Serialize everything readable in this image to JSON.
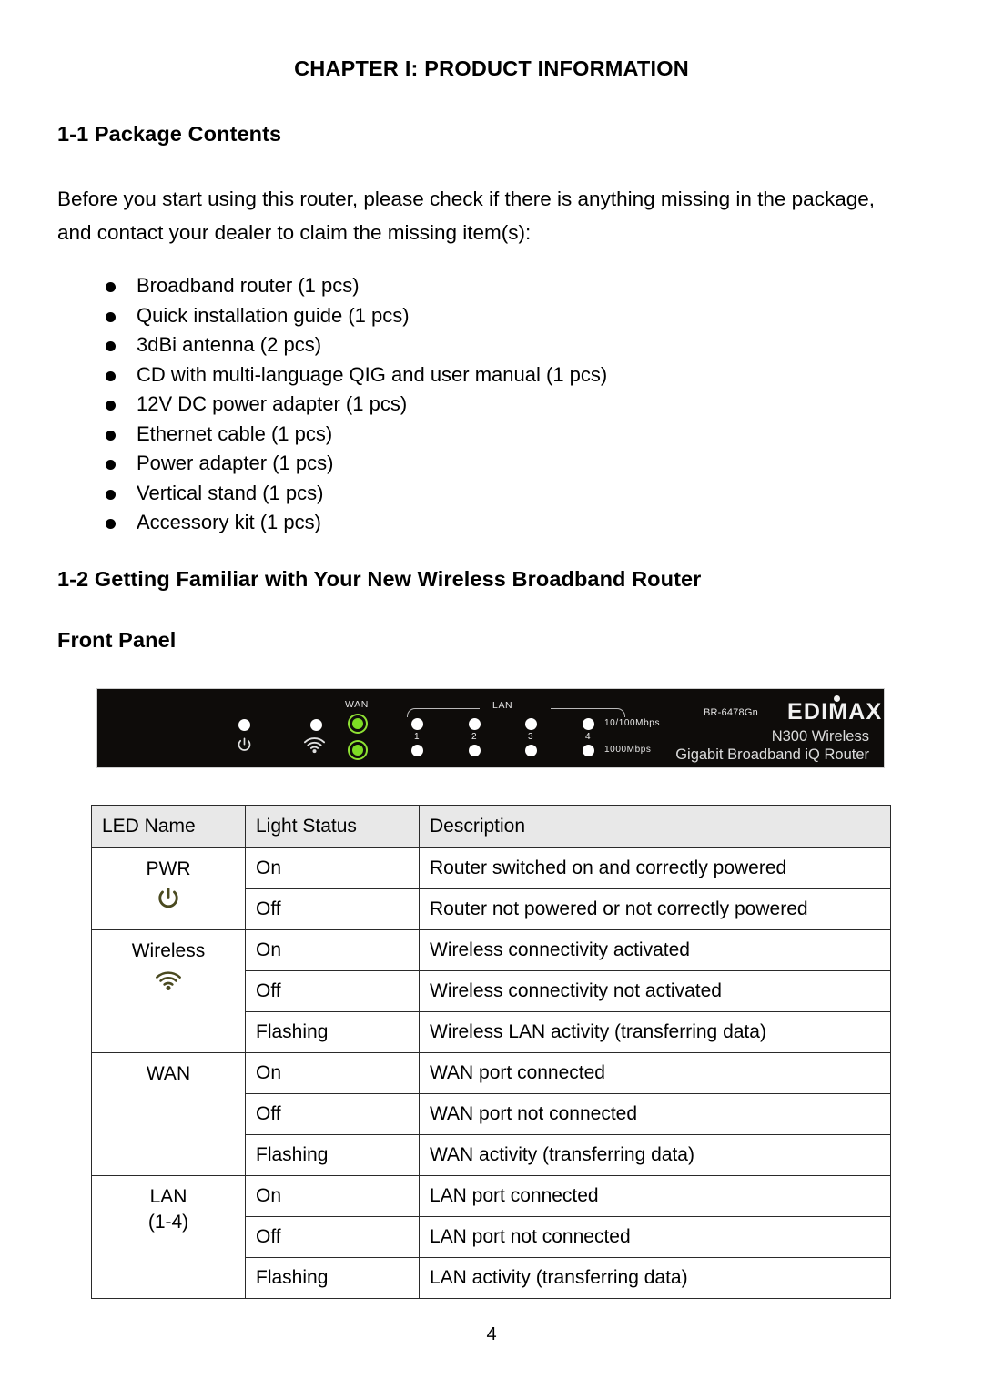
{
  "document": {
    "chapter_title": "CHAPTER I: PRODUCT INFORMATION",
    "page_number": "4"
  },
  "sections": {
    "package_contents": {
      "heading": "1-1 Package Contents",
      "intro": "Before you start using this router, please check if there is anything missing in the package, and contact your dealer to claim the missing item(s):",
      "items": [
        "Broadband router (1 pcs)",
        "Quick installation guide (1 pcs)",
        "3dBi antenna (2 pcs)",
        "CD with multi-language QIG and user manual (1 pcs)",
        "12V DC power adapter (1 pcs)",
        "Ethernet cable (1 pcs)",
        "Power adapter (1 pcs)",
        "Vertical stand (1 pcs)",
        "Accessory kit (1 pcs)"
      ]
    },
    "getting_familiar": {
      "heading": "1-2 Getting Familiar with Your New Wireless Broadband Router",
      "subheading": "Front Panel"
    }
  },
  "front_panel_image": {
    "labels": {
      "wan": "WAN",
      "lan": "LAN",
      "speed_10_100": "10/100Mbps",
      "speed_1000": "1000Mbps",
      "port_1": "1",
      "port_2": "2",
      "port_3": "3",
      "port_4": "4"
    },
    "branding": {
      "model": "BR-6478Gn",
      "logo": "EDIMAX",
      "line1": "N300 Wireless",
      "line2": "Gigabit Broadband iQ Router"
    },
    "colors": {
      "panel_background": "#0e0c0a",
      "led_off": "#ffffff",
      "led_on_green": "#7ddc24",
      "label_text": "#e6e6e6"
    },
    "icons": {
      "power": "power-icon",
      "wireless": "wifi-icon"
    }
  },
  "led_table": {
    "headers": [
      "LED Name",
      "Light Status",
      "Description"
    ],
    "header_background": "#e8e8e8",
    "icon_color": "#4a4a20",
    "groups": [
      {
        "name": "PWR",
        "sub": "",
        "icon": "power-icon",
        "rows": [
          {
            "status": "On",
            "description": "Router switched on and correctly powered"
          },
          {
            "status": "Off",
            "description": "Router not powered or not correctly powered"
          }
        ]
      },
      {
        "name": "Wireless",
        "sub": "",
        "icon": "wifi-icon",
        "rows": [
          {
            "status": "On",
            "description": "Wireless connectivity activated"
          },
          {
            "status": "Off",
            "description": "Wireless connectivity not activated"
          },
          {
            "status": "Flashing",
            "description": "Wireless LAN activity (transferring data)"
          }
        ]
      },
      {
        "name": "WAN",
        "sub": "",
        "icon": "",
        "rows": [
          {
            "status": "On",
            "description": "WAN port connected"
          },
          {
            "status": "Off",
            "description": "WAN port not connected"
          },
          {
            "status": "Flashing",
            "description": "WAN activity (transferring data)"
          }
        ]
      },
      {
        "name": "LAN",
        "sub": "(1-4)",
        "icon": "",
        "rows": [
          {
            "status": "On",
            "description": "LAN port connected"
          },
          {
            "status": "Off",
            "description": "LAN port not connected"
          },
          {
            "status": "Flashing",
            "description": "LAN activity (transferring data)"
          }
        ]
      }
    ]
  }
}
